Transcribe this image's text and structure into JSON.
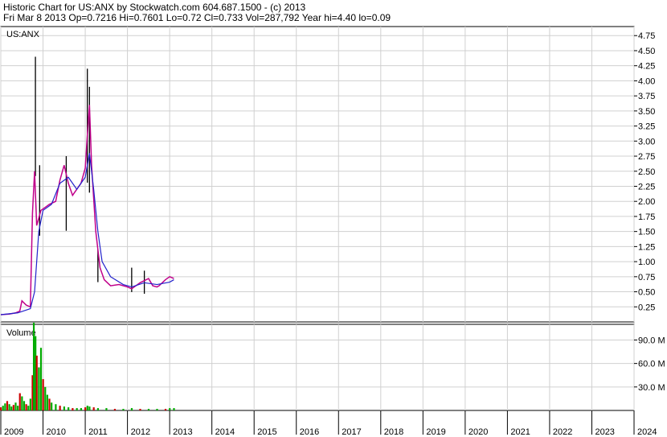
{
  "header": {
    "line1": "Historic Chart for US:ANX by Stockwatch.com 604.687.1500 - (c) 2013",
    "line2": "Fri Mar  8 2013  Op=0.7216  Hi=0.7601  Lo=0.72  Cl=0.733  Vol=287,792  Year hi=4.40  lo=0.09"
  },
  "chart_data": {
    "type": "line",
    "price_panel": {
      "symbol": "US:ANX",
      "ylim": [
        0,
        4.9
      ],
      "y_ticks": [
        "0.25",
        "0.50",
        "0.75",
        "1.00",
        "1.25",
        "1.50",
        "1.75",
        "2.00",
        "2.25",
        "2.50",
        "2.75",
        "3.00",
        "3.25",
        "3.50",
        "3.75",
        "4.00",
        "4.25",
        "4.50",
        "4.75"
      ],
      "price_series": [
        [
          2009.0,
          0.12
        ],
        [
          2009.2,
          0.13
        ],
        [
          2009.35,
          0.15
        ],
        [
          2009.45,
          0.18
        ],
        [
          2009.5,
          0.35
        ],
        [
          2009.6,
          0.28
        ],
        [
          2009.7,
          0.25
        ],
        [
          2009.75,
          1.8
        ],
        [
          2009.8,
          2.5
        ],
        [
          2009.85,
          1.6
        ],
        [
          2009.95,
          1.85
        ],
        [
          2010.05,
          1.9
        ],
        [
          2010.15,
          1.95
        ],
        [
          2010.3,
          2.0
        ],
        [
          2010.4,
          2.35
        ],
        [
          2010.5,
          2.6
        ],
        [
          2010.6,
          2.3
        ],
        [
          2010.7,
          2.1
        ],
        [
          2010.8,
          2.2
        ],
        [
          2010.9,
          2.3
        ],
        [
          2011.0,
          2.55
        ],
        [
          2011.05,
          3.1
        ],
        [
          2011.1,
          3.6
        ],
        [
          2011.15,
          2.6
        ],
        [
          2011.25,
          1.5
        ],
        [
          2011.35,
          0.9
        ],
        [
          2011.45,
          0.7
        ],
        [
          2011.6,
          0.6
        ],
        [
          2011.8,
          0.62
        ],
        [
          2012.0,
          0.58
        ],
        [
          2012.1,
          0.55
        ],
        [
          2012.3,
          0.65
        ],
        [
          2012.5,
          0.72
        ],
        [
          2012.6,
          0.6
        ],
        [
          2012.7,
          0.58
        ],
        [
          2012.75,
          0.6
        ],
        [
          2012.9,
          0.7
        ],
        [
          2013.0,
          0.75
        ],
        [
          2013.1,
          0.72
        ]
      ],
      "spikes": [
        [
          2009.82,
          4.4
        ],
        [
          2009.92,
          2.6
        ],
        [
          2010.55,
          2.75
        ],
        [
          2011.05,
          4.2
        ],
        [
          2011.1,
          3.9
        ],
        [
          2011.3,
          1.2
        ],
        [
          2012.1,
          0.9
        ],
        [
          2012.4,
          0.85
        ]
      ],
      "moving_average": [
        [
          2009.0,
          0.12
        ],
        [
          2009.4,
          0.15
        ],
        [
          2009.7,
          0.22
        ],
        [
          2009.8,
          0.5
        ],
        [
          2009.9,
          1.5
        ],
        [
          2010.0,
          1.85
        ],
        [
          2010.2,
          1.95
        ],
        [
          2010.4,
          2.3
        ],
        [
          2010.6,
          2.4
        ],
        [
          2010.8,
          2.2
        ],
        [
          2011.0,
          2.4
        ],
        [
          2011.1,
          2.8
        ],
        [
          2011.2,
          2.2
        ],
        [
          2011.3,
          1.5
        ],
        [
          2011.4,
          1.0
        ],
        [
          2011.6,
          0.75
        ],
        [
          2011.9,
          0.62
        ],
        [
          2012.1,
          0.58
        ],
        [
          2012.4,
          0.65
        ],
        [
          2012.7,
          0.62
        ],
        [
          2013.0,
          0.66
        ],
        [
          2013.1,
          0.7
        ]
      ]
    },
    "volume_panel": {
      "label": "Volume",
      "ylim": [
        0,
        110
      ],
      "y_ticks": [
        "30.0 M",
        "60.0 M",
        "90.0 M"
      ],
      "bars": [
        [
          2009.0,
          4
        ],
        [
          2009.05,
          6
        ],
        [
          2009.1,
          9
        ],
        [
          2009.15,
          12
        ],
        [
          2009.2,
          8
        ],
        [
          2009.25,
          5
        ],
        [
          2009.3,
          7
        ],
        [
          2009.35,
          10
        ],
        [
          2009.4,
          6
        ],
        [
          2009.45,
          22
        ],
        [
          2009.5,
          18
        ],
        [
          2009.55,
          12
        ],
        [
          2009.6,
          8
        ],
        [
          2009.65,
          6
        ],
        [
          2009.7,
          15
        ],
        [
          2009.75,
          45
        ],
        [
          2009.78,
          112
        ],
        [
          2009.82,
          95
        ],
        [
          2009.85,
          70
        ],
        [
          2009.9,
          55
        ],
        [
          2009.95,
          80
        ],
        [
          2010.0,
          40
        ],
        [
          2010.05,
          30
        ],
        [
          2010.1,
          20
        ],
        [
          2010.15,
          15
        ],
        [
          2010.2,
          10
        ],
        [
          2010.3,
          8
        ],
        [
          2010.4,
          6
        ],
        [
          2010.5,
          5
        ],
        [
          2010.6,
          4
        ],
        [
          2010.7,
          3
        ],
        [
          2010.8,
          3
        ],
        [
          2010.9,
          3
        ],
        [
          2011.0,
          4
        ],
        [
          2011.05,
          6
        ],
        [
          2011.1,
          5
        ],
        [
          2011.2,
          4
        ],
        [
          2011.3,
          3
        ],
        [
          2011.5,
          3
        ],
        [
          2011.7,
          2
        ],
        [
          2011.9,
          2
        ],
        [
          2012.1,
          3
        ],
        [
          2012.3,
          2
        ],
        [
          2012.5,
          2
        ],
        [
          2012.7,
          2
        ],
        [
          2012.9,
          2
        ],
        [
          2013.0,
          3
        ],
        [
          2013.1,
          3
        ]
      ]
    },
    "x_axis": {
      "xlim": [
        2009.0,
        2024.0
      ],
      "labels": [
        "2009",
        "2010",
        "2011",
        "2012",
        "2013",
        "2014",
        "2015",
        "2016",
        "2017",
        "2018",
        "2019",
        "2020",
        "2021",
        "2022",
        "2023",
        "2024"
      ]
    },
    "grid": true
  }
}
